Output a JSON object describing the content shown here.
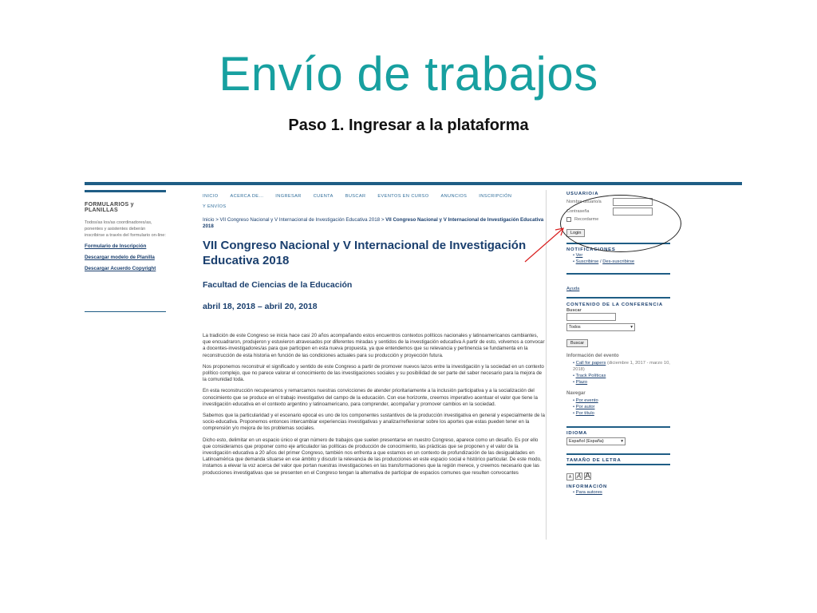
{
  "slide": {
    "title": "Envío de trabajos",
    "subtitle": "Paso 1. Ingresar a la plataforma"
  },
  "left": {
    "heading": "FORMULARIOS y PLANILLAS",
    "intro": "Todos/as los/as coordinadores/as, ponentes y asistentes deberán inscribirse a través del formulario on-line:",
    "links": [
      "Formulario de Inscripción",
      "Descargar modelo de Planilla",
      "Descargar Acuerdo Copyright"
    ]
  },
  "nav": {
    "items": [
      "INICIO",
      "ACERCA DE...",
      "INGRESAR",
      "CUENTA",
      "BUSCAR",
      "EVENTOS EN CURSO",
      "ANUNCIOS",
      "INSCRIPCIÓN"
    ],
    "second_row": "Y ENVÍOS"
  },
  "breadcrumb": {
    "home": "Inicio",
    "sep": ">",
    "item1": "VII Congreso Nacional y V Internacional de Investigación Educativa 2018",
    "item2": "VII Congreso Nacional y V Internacional de Investigación Educativa 2018"
  },
  "main": {
    "title": "VII Congreso Nacional y V Internacional de Investigación Educativa 2018",
    "faculty": "Facultad de Ciencias de la Educación",
    "dates": "abril 18, 2018 – abril 20, 2018",
    "paragraphs": [
      "La tradición de este Congreso se inicia hace casi 20 años acompañando estos encuentros contextos políticos nacionales y latinoamericanos cambiantes, que encuadraron, produjeron y estuvieron atravesados por diferentes miradas y sentidos de la investigación educativa A partir de esto, volvemos a convocar a docentes-investigadores/as para que participen en esta nueva propuesta, ya que entendemos que su relevancia y pertinencia se fundamenta en la reconstrucción de esta historia en función de las condiciones actuales para su producción y proyección futura.",
      "Nos proponemos reconstruir el significado y sentido de este Congreso a partir de promover nuevos lazos entre la investigación y la sociedad en un contexto político complejo, que no parece valorar el conocimiento de las investigaciones sociales y su posibilidad de ser parte del saber necesario para la mejora de la comunidad toda.",
      "En esta reconstrucción recuperamos y remarcamos nuestras convicciones de atender prioritariamente a la inclusión participativa y a la socialización del conocimiento que se produce en el trabajo investigativo del campo de la educación. Con ese horizonte, creemos imperativo acentuar el valor que tiene la investigación educativa en el contexto argentino y latinoamericano, para comprender, acompañar y promover cambios en la sociedad.",
      "Sabemos que la particularidad y el escenario epocal es uno de los componentes sustantivos de la producción investigativa en general y especialmente de la socio-educativa. Proponemos entonces intercambiar experiencias investigativas y analizar/reflexionar sobre los aportes que estas pueden tener en la comprensión y/o mejora de los problemas sociales.",
      "Dicho esto, delimitar en un espacio único el gran número de trabajos que suelen presentarse en nuestro Congreso, aparece como un desafío. Es por ello que consideramos que proponer como eje articulador las políticas de producción de conocimiento, las prácticas que se proponen y el valor de la investigación educativa a 20 años del primer Congreso, también nos enfrenta a que estamos en un contexto de profundización de las desigualdades en Latinoamérica que demanda situarse en ese ámbito y discutir la relevancia de las producciones en este espacio social e histórico particular. De este modo, instamos a elevar la voz acerca del valor que portan nuestras investigaciones en las transformaciones que la región merece, y creemos necesario que las producciones investigativas que se presenten en el Congreso tengan la alternativa de participar de espacios comunes que resulten convocantes"
    ]
  },
  "right": {
    "user": {
      "heading": "USUARIO/A",
      "username_label": "Nombre usuario/a",
      "password_label": "Contraseña",
      "remember_label": "Recordarme",
      "login_button": "Login"
    },
    "notifications": {
      "heading": "NOTIFICACIONES",
      "view": "Ver",
      "subscribe": "Suscribirse",
      "sep": "/",
      "unsubscribe": "Des-suscribirse"
    },
    "help": "Ayuda",
    "conference": {
      "heading": "CONTENIDO DE LA CONFERENCIA",
      "search_label": "Buscar",
      "select_value": "Todos",
      "search_button": "Buscar",
      "event_info": "Información del evento",
      "call_link": "Call for papers",
      "call_text": "(diciembre 1, 2017 - marzo 10, 2018)",
      "tracks": "Track Políticas",
      "plazo": "Plazo",
      "browse": "Navegar",
      "by_event": "Por evento",
      "by_author": "Por autor",
      "by_title": "Por título"
    },
    "language": {
      "heading": "IDIOMA",
      "value": "Español (España)"
    },
    "font_size": {
      "heading": "TAMAÑO DE LETRA",
      "boxes": [
        "A",
        "A",
        "A"
      ]
    },
    "info": {
      "heading": "INFORMACIÓN",
      "authors": "Para autores"
    }
  }
}
